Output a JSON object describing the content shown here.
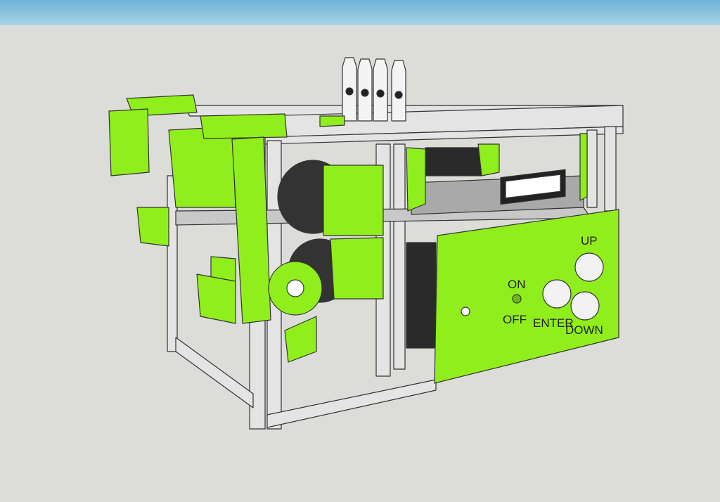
{
  "viewport": {
    "sky_color": "#8cc4de",
    "ground_color": "#dcdcd9"
  },
  "model": {
    "part_color": "#90ee1c",
    "frame_color": "#e6e6e6",
    "control_panel": {
      "power_switch": {
        "on_label": "ON",
        "off_label": "OFF"
      },
      "buttons": [
        {
          "label": "UP"
        },
        {
          "label": "ENTER"
        },
        {
          "label": "DOWN"
        }
      ],
      "display": "lcd"
    },
    "marker_count": 4
  }
}
